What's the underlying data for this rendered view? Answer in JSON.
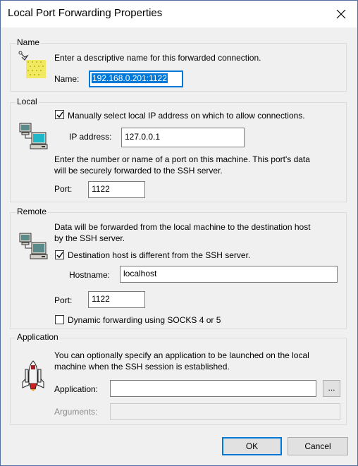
{
  "window": {
    "title": "Local Port Forwarding Properties"
  },
  "name_group": {
    "title": "Name",
    "description": "Enter a descriptive name for this forwarded connection.",
    "name_label": "Name:",
    "name_value": "192.168.0.201:1122"
  },
  "local_group": {
    "title": "Local",
    "manual_checkbox_label": "Manually select local IP address on which to allow connections.",
    "manual_checked": true,
    "ip_label": "IP address:",
    "ip_value": "127.0.0.1",
    "port_description_1": "Enter the number or name of a port on this machine.  This port's data",
    "port_description_2": "will be securely forwarded to the SSH server.",
    "port_label": "Port:",
    "port_value": "1122"
  },
  "remote_group": {
    "title": "Remote",
    "description_1": "Data will be forwarded from the local machine to the destination host",
    "description_2": "by the SSH server.",
    "dest_checkbox_label": "Destination host is different from the SSH server.",
    "dest_checked": true,
    "hostname_label": "Hostname:",
    "hostname_value": "localhost",
    "port_label": "Port:",
    "port_value": "1122",
    "dynamic_checkbox_label": "Dynamic forwarding using SOCKS 4 or 5",
    "dynamic_checked": false
  },
  "application_group": {
    "title": "Application",
    "description_1": "You can optionally specify an application to be launched on the local",
    "description_2": "machine when the SSH session is established.",
    "application_label": "Application:",
    "application_value": "",
    "browse_label": "...",
    "arguments_label": "Arguments:",
    "arguments_value": ""
  },
  "buttons": {
    "ok": "OK",
    "cancel": "Cancel"
  },
  "icons": {
    "name": "tag-icon",
    "local": "local-computer-icon",
    "remote": "remote-computer-icon",
    "application": "rocket-icon",
    "close": "close-icon"
  },
  "colors": {
    "accent": "#0078d7",
    "window_bg": "#f0f0f0",
    "title_bg": "#ffffff"
  }
}
